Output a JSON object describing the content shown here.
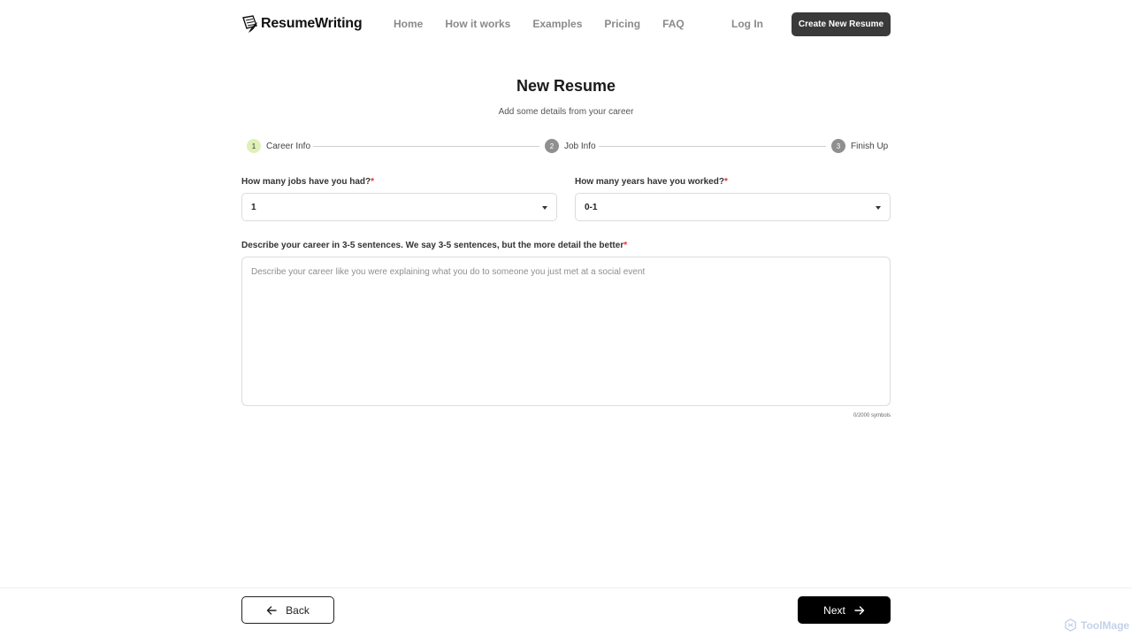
{
  "header": {
    "brand": "ResumeWriting",
    "nav": [
      "Home",
      "How it works",
      "Examples",
      "Pricing",
      "FAQ"
    ],
    "login": "Log In",
    "create_button": "Create New Resume"
  },
  "page": {
    "title": "New Resume",
    "subtitle": "Add some details from your career"
  },
  "stepper": {
    "steps": [
      {
        "number": "1",
        "label": "Career Info",
        "state": "active"
      },
      {
        "number": "2",
        "label": "Job Info",
        "state": "inactive"
      },
      {
        "number": "3",
        "label": "Finish Up",
        "state": "inactive"
      }
    ]
  },
  "form": {
    "jobs": {
      "label": "How many jobs have you had?",
      "required": "*",
      "value": "1"
    },
    "years": {
      "label": "How many years have you worked?",
      "required": "*",
      "value": "0-1"
    },
    "career": {
      "label": "Describe your career in 3-5 sentences. We say 3-5 sentences, but the more detail the better",
      "required": "*",
      "placeholder": "Describe your career like you were explaining what you do to someone you just met at a social event",
      "value": "",
      "counter": "0/2000 symbols"
    }
  },
  "footer": {
    "back_label": "Back",
    "next_label": "Next"
  },
  "watermark": "ToolMage",
  "colors": {
    "primary_button": "#000000",
    "header_button": "#3a3a3a",
    "active_step": "#dff0b8",
    "required": "#e03131"
  },
  "icons": {
    "logo": "feather-paper-icon",
    "back": "arrow-left-icon",
    "next": "arrow-right-icon",
    "select": "caret-down-icon"
  }
}
